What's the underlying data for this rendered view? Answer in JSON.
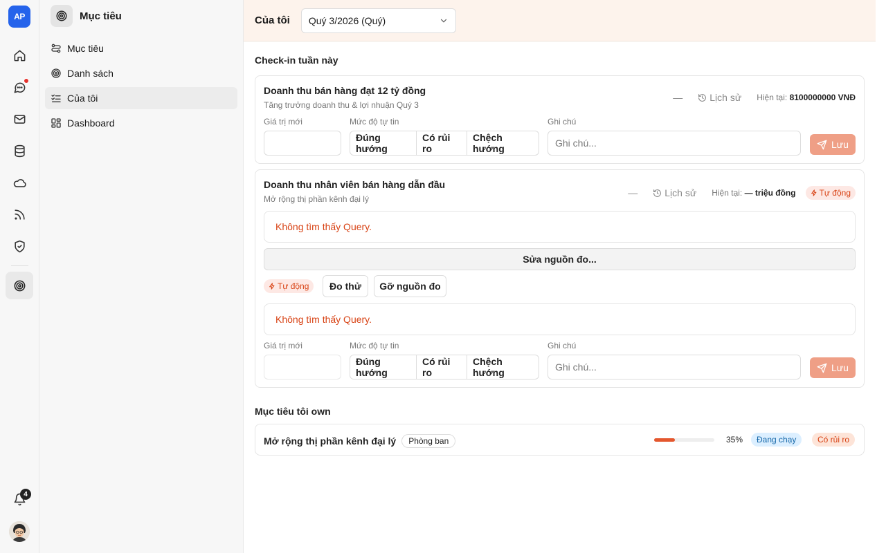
{
  "rail": {
    "logo": "AP",
    "notifications_count": "4"
  },
  "sidebar": {
    "title": "Mục tiêu",
    "items": [
      {
        "label": "Mục tiêu",
        "icon": "goals-icon"
      },
      {
        "label": "Danh sách",
        "icon": "target-icon"
      },
      {
        "label": "Của tôi",
        "icon": "checklist-icon"
      },
      {
        "label": "Dashboard",
        "icon": "dashboard-icon"
      }
    ]
  },
  "topbar": {
    "label": "Của tôi",
    "period_select": "Quý 3/2026 (Quý)"
  },
  "checkin": {
    "section_title": "Check-in tuần này",
    "card1": {
      "title": "Doanh thu bán hàng đạt 12 tỷ đồng",
      "subtitle": "Tăng trưởng doanh thu & lợi nhuận Quý 3",
      "dash": "—",
      "history": "Lịch sử",
      "current_label": "Hiện tại:",
      "current_value": "8100000000 VNĐ",
      "new_value_label": "Giá trị mới",
      "confidence_label": "Mức độ tự tin",
      "confidence_options": [
        "Đúng hướng",
        "Có rủi ro",
        "Chệch hướng"
      ],
      "note_label": "Ghi chú",
      "note_placeholder": "Ghi chú...",
      "save": "Lưu"
    },
    "card2": {
      "title": "Doanh thu nhân viên bán hàng dẫn đầu",
      "subtitle": "Mở rộng thị phần kênh đại lý",
      "dash": "—",
      "history": "Lịch sử",
      "current_label": "Hiện tại:",
      "current_value": "— triệu đồng",
      "auto_badge": "Tự động",
      "error1": "Không tìm thấy Query.",
      "fix_source": "Sửa nguồn đo...",
      "auto_badge2": "Tự động",
      "test_measure": "Đo thử",
      "remove_source": "Gỡ nguồn đo",
      "error2": "Không tìm thấy Query.",
      "new_value_label": "Giá trị mới",
      "confidence_label": "Mức độ tự tin",
      "confidence_options": [
        "Đúng hướng",
        "Có rủi ro",
        "Chệch hướng"
      ],
      "note_label": "Ghi chú",
      "note_placeholder": "Ghi chú...",
      "save": "Lưu"
    }
  },
  "own": {
    "section_title": "Mục tiêu tôi own",
    "item": {
      "title": "Mở rộng thị phần kênh đại lý",
      "chip": "Phòng ban",
      "progress": 0.35,
      "progress_label": "35%",
      "status": "Đang chạy",
      "risk": "Có rủi ro"
    }
  },
  "colors": {
    "accent": "#e4572e",
    "save_button": "#ef9f86",
    "topbar_bg": "#fdf3ec",
    "error_text": "#d84315",
    "logo_bg": "#2563eb"
  }
}
